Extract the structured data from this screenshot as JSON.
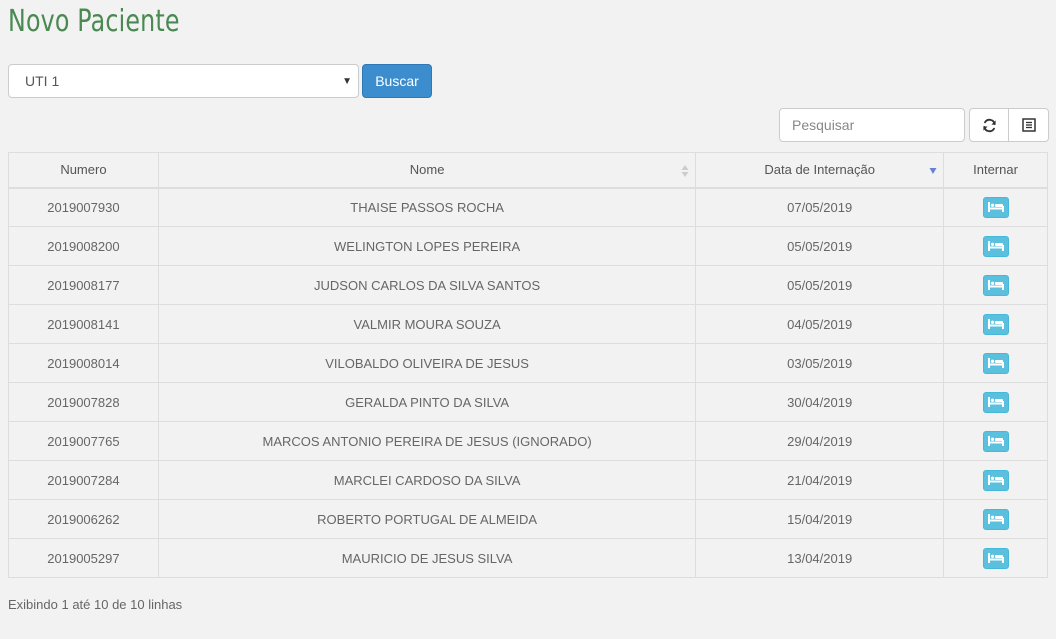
{
  "page": {
    "title": "Novo Paciente"
  },
  "filter": {
    "selected_unit": "UTI 1",
    "search_button": "Buscar"
  },
  "toolbar": {
    "search_placeholder": "Pesquisar",
    "refresh_icon": "refresh-icon",
    "columns_icon": "columns-icon"
  },
  "table": {
    "headers": {
      "numero": "Numero",
      "nome": "Nome",
      "data": "Data de Internação",
      "internar": "Internar"
    },
    "rows": [
      {
        "numero": "2019007930",
        "nome": "THAISE PASSOS ROCHA",
        "data": "07/05/2019"
      },
      {
        "numero": "2019008200",
        "nome": "WELINGTON LOPES PEREIRA",
        "data": "05/05/2019"
      },
      {
        "numero": "2019008177",
        "nome": "JUDSON CARLOS DA SILVA SANTOS",
        "data": "05/05/2019"
      },
      {
        "numero": "2019008141",
        "nome": "VALMIR MOURA SOUZA",
        "data": "04/05/2019"
      },
      {
        "numero": "2019008014",
        "nome": "VILOBALDO OLIVEIRA DE JESUS",
        "data": "03/05/2019"
      },
      {
        "numero": "2019007828",
        "nome": "GERALDA PINTO DA SILVA",
        "data": "30/04/2019"
      },
      {
        "numero": "2019007765",
        "nome": "MARCOS ANTONIO PEREIRA DE JESUS (IGNORADO)",
        "data": "29/04/2019"
      },
      {
        "numero": "2019007284",
        "nome": "MARCLEI CARDOSO DA SILVA",
        "data": "21/04/2019"
      },
      {
        "numero": "2019006262",
        "nome": "ROBERTO PORTUGAL DE ALMEIDA",
        "data": "15/04/2019"
      },
      {
        "numero": "2019005297",
        "nome": "MAURICIO DE JESUS SILVA",
        "data": "13/04/2019"
      }
    ]
  },
  "pagination": {
    "info": "Exibindo 1 até 10 de 10 linhas"
  },
  "colors": {
    "title": "#4a8a52",
    "primary": "#3c8dcd",
    "info": "#5bc0de",
    "background": "#f2f2f2"
  }
}
